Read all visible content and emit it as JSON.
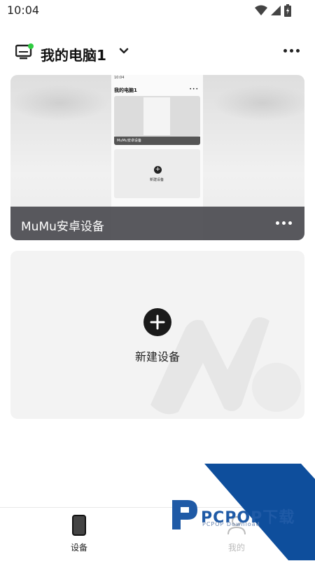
{
  "status": {
    "time": "10:04"
  },
  "header": {
    "title": "我的电脑1"
  },
  "device_card": {
    "name": "MuMu安卓设备",
    "preview": {
      "time": "10:04",
      "title": "我的电脑1",
      "device_label": "MuMu安卓设备",
      "new_label": "新建设备"
    }
  },
  "new_device": {
    "label": "新建设备"
  },
  "bottom_nav": [
    {
      "label": "设备",
      "active": true
    },
    {
      "label": "我的",
      "active": false
    }
  ],
  "watermark": {
    "brand": "PCPOP下载",
    "sub": "PCPOP Download"
  },
  "colors": {
    "online": "#2ecc40",
    "watermark_blue": "#0e4e9c"
  }
}
